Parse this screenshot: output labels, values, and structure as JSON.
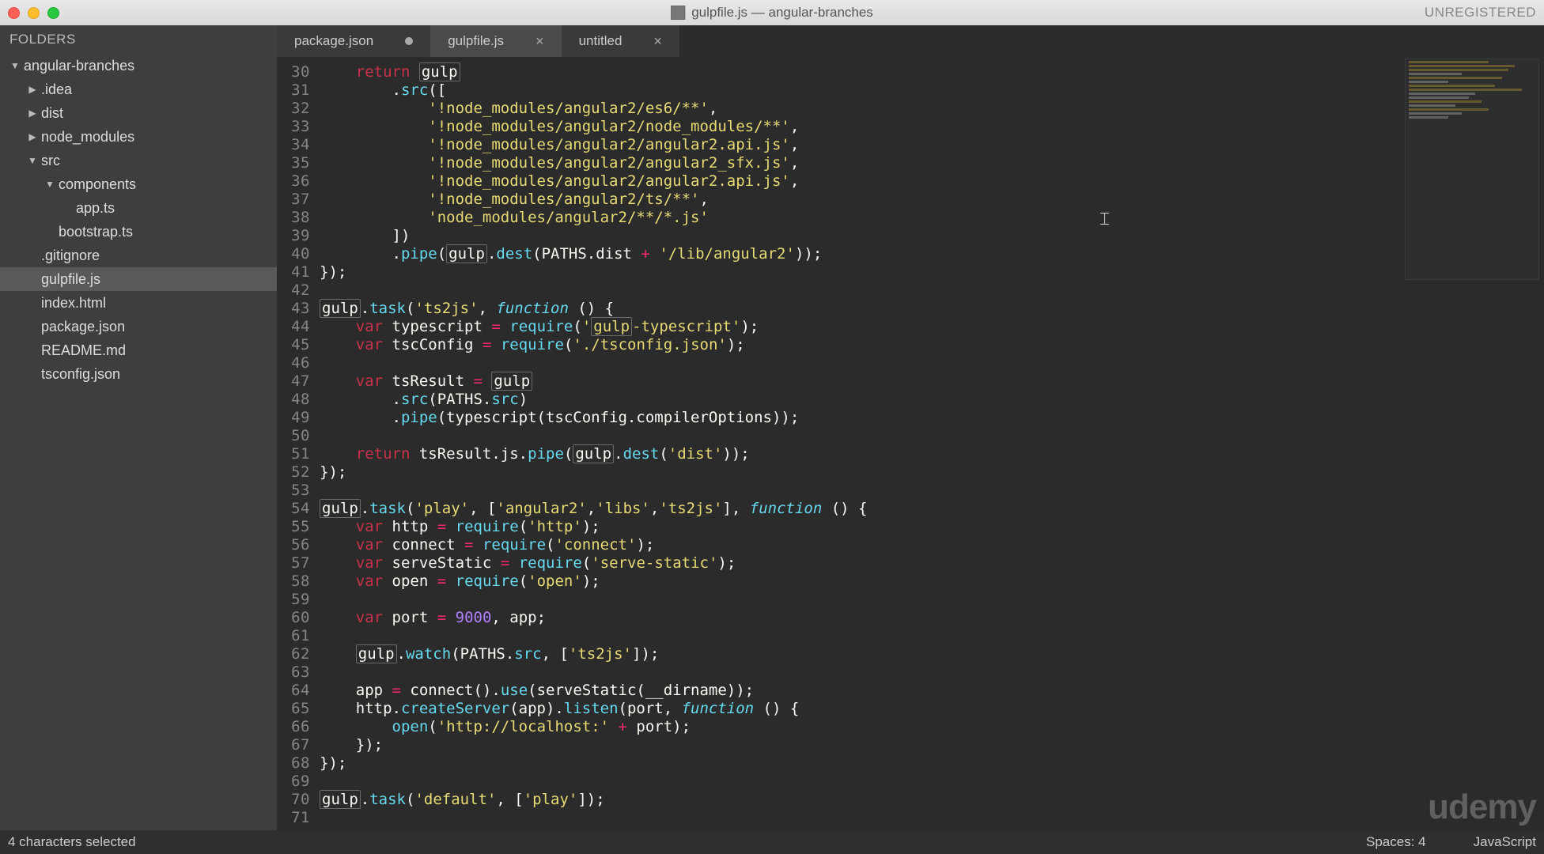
{
  "window": {
    "title": "gulpfile.js — angular-branches",
    "unregistered": "UNREGISTERED"
  },
  "sidebar": {
    "header": "FOLDERS",
    "tree": [
      {
        "label": "angular-branches",
        "indent": 0,
        "expanded": true,
        "folder": true
      },
      {
        "label": ".idea",
        "indent": 1,
        "expanded": false,
        "folder": true
      },
      {
        "label": "dist",
        "indent": 1,
        "expanded": false,
        "folder": true
      },
      {
        "label": "node_modules",
        "indent": 1,
        "expanded": false,
        "folder": true
      },
      {
        "label": "src",
        "indent": 1,
        "expanded": true,
        "folder": true
      },
      {
        "label": "components",
        "indent": 2,
        "expanded": true,
        "folder": true
      },
      {
        "label": "app.ts",
        "indent": 3,
        "folder": false
      },
      {
        "label": "bootstrap.ts",
        "indent": 2,
        "folder": false
      },
      {
        "label": ".gitignore",
        "indent": 1,
        "folder": false
      },
      {
        "label": "gulpfile.js",
        "indent": 1,
        "folder": false,
        "selected": true
      },
      {
        "label": "index.html",
        "indent": 1,
        "folder": false
      },
      {
        "label": "package.json",
        "indent": 1,
        "folder": false
      },
      {
        "label": "README.md",
        "indent": 1,
        "folder": false
      },
      {
        "label": "tsconfig.json",
        "indent": 1,
        "folder": false
      }
    ]
  },
  "tabs": [
    {
      "label": "package.json",
      "active": false,
      "dirty": true
    },
    {
      "label": "gulpfile.js",
      "active": true,
      "dirty": false
    },
    {
      "label": "untitled",
      "active": false,
      "dirty": false
    }
  ],
  "editor": {
    "first_line": 30,
    "last_line": 71,
    "lines": [
      {
        "n": 30,
        "tokens": [
          [
            "    ",
            "p"
          ],
          [
            "return",
            "kw"
          ],
          [
            " ",
            "p"
          ],
          [
            "gulp",
            "boxed"
          ]
        ]
      },
      {
        "n": 31,
        "tokens": [
          [
            "        .",
            "p"
          ],
          [
            "src",
            "method"
          ],
          [
            "([",
            "p"
          ]
        ]
      },
      {
        "n": 32,
        "tokens": [
          [
            "            ",
            "p"
          ],
          [
            "'!node_modules/angular2/es6/**'",
            "str"
          ],
          [
            ",",
            "p"
          ]
        ]
      },
      {
        "n": 33,
        "tokens": [
          [
            "            ",
            "p"
          ],
          [
            "'!node_modules/angular2/node_modules/**'",
            "str"
          ],
          [
            ",",
            "p"
          ]
        ]
      },
      {
        "n": 34,
        "tokens": [
          [
            "            ",
            "p"
          ],
          [
            "'!node_modules/angular2/angular2.api.js'",
            "str"
          ],
          [
            ",",
            "p"
          ]
        ]
      },
      {
        "n": 35,
        "tokens": [
          [
            "            ",
            "p"
          ],
          [
            "'!node_modules/angular2/angular2_sfx.js'",
            "str"
          ],
          [
            ",",
            "p"
          ]
        ]
      },
      {
        "n": 36,
        "tokens": [
          [
            "            ",
            "p"
          ],
          [
            "'!node_modules/angular2/angular2.api.js'",
            "str"
          ],
          [
            ",",
            "p"
          ]
        ]
      },
      {
        "n": 37,
        "tokens": [
          [
            "            ",
            "p"
          ],
          [
            "'!node_modules/angular2/ts/**'",
            "str"
          ],
          [
            ",",
            "p"
          ]
        ]
      },
      {
        "n": 38,
        "tokens": [
          [
            "            ",
            "p"
          ],
          [
            "'node_modules/angular2/**/*.js'",
            "str"
          ]
        ]
      },
      {
        "n": 39,
        "tokens": [
          [
            "        ])",
            "p"
          ]
        ]
      },
      {
        "n": 40,
        "tokens": [
          [
            "        .",
            "p"
          ],
          [
            "pipe",
            "method"
          ],
          [
            "(",
            "p"
          ],
          [
            "gulp",
            "boxed"
          ],
          [
            ".",
            "p"
          ],
          [
            "dest",
            "method"
          ],
          [
            "(PATHS.dist ",
            "p"
          ],
          [
            "+",
            "op"
          ],
          [
            " ",
            "p"
          ],
          [
            "'/lib/angular2'",
            "str"
          ],
          [
            "));",
            "p"
          ]
        ]
      },
      {
        "n": 41,
        "tokens": [
          [
            "});",
            "p"
          ]
        ]
      },
      {
        "n": 42,
        "tokens": [
          [
            "",
            "p"
          ]
        ]
      },
      {
        "n": 43,
        "tokens": [
          [
            "gulp",
            "boxed"
          ],
          [
            ".",
            "p"
          ],
          [
            "task",
            "method"
          ],
          [
            "(",
            "p"
          ],
          [
            "'ts2js'",
            "str"
          ],
          [
            ", ",
            "p"
          ],
          [
            "function",
            "fn"
          ],
          [
            " () {",
            "p"
          ]
        ]
      },
      {
        "n": 44,
        "tokens": [
          [
            "    ",
            "p"
          ],
          [
            "var",
            "kw"
          ],
          [
            " typescript ",
            "p"
          ],
          [
            "=",
            "op"
          ],
          [
            " ",
            "p"
          ],
          [
            "require",
            "method"
          ],
          [
            "(",
            "p"
          ],
          [
            "'",
            "str"
          ],
          [
            "gulp",
            "str boxed"
          ],
          [
            "-typescript'",
            "str"
          ],
          [
            ");",
            "p"
          ]
        ]
      },
      {
        "n": 45,
        "tokens": [
          [
            "    ",
            "p"
          ],
          [
            "var",
            "kw"
          ],
          [
            " tscConfig ",
            "p"
          ],
          [
            "=",
            "op"
          ],
          [
            " ",
            "p"
          ],
          [
            "require",
            "method"
          ],
          [
            "(",
            "p"
          ],
          [
            "'./tsconfig.json'",
            "str"
          ],
          [
            ");",
            "p"
          ]
        ]
      },
      {
        "n": 46,
        "tokens": [
          [
            "",
            "p"
          ]
        ]
      },
      {
        "n": 47,
        "tokens": [
          [
            "    ",
            "p"
          ],
          [
            "var",
            "kw"
          ],
          [
            " tsResult ",
            "p"
          ],
          [
            "=",
            "op"
          ],
          [
            " ",
            "p"
          ],
          [
            "gulp",
            "boxed"
          ]
        ]
      },
      {
        "n": 48,
        "tokens": [
          [
            "        .",
            "p"
          ],
          [
            "src",
            "method"
          ],
          [
            "(PATHS.",
            "p"
          ],
          [
            "src",
            "method"
          ],
          [
            ")",
            "p"
          ]
        ]
      },
      {
        "n": 49,
        "tokens": [
          [
            "        .",
            "p"
          ],
          [
            "pipe",
            "method"
          ],
          [
            "(typescript(tscConfig.compilerOptions));",
            "p"
          ]
        ]
      },
      {
        "n": 50,
        "tokens": [
          [
            "",
            "p"
          ]
        ]
      },
      {
        "n": 51,
        "tokens": [
          [
            "    ",
            "p"
          ],
          [
            "return",
            "kw"
          ],
          [
            " tsResult.js.",
            "p"
          ],
          [
            "pipe",
            "method"
          ],
          [
            "(",
            "p"
          ],
          [
            "gulp",
            "boxed"
          ],
          [
            ".",
            "p"
          ],
          [
            "dest",
            "method"
          ],
          [
            "(",
            "p"
          ],
          [
            "'dist'",
            "str"
          ],
          [
            "));",
            "p"
          ]
        ]
      },
      {
        "n": 52,
        "tokens": [
          [
            "});",
            "p"
          ]
        ]
      },
      {
        "n": 53,
        "tokens": [
          [
            "",
            "p"
          ]
        ]
      },
      {
        "n": 54,
        "tokens": [
          [
            "gulp",
            "boxed"
          ],
          [
            ".",
            "p"
          ],
          [
            "task",
            "method"
          ],
          [
            "(",
            "p"
          ],
          [
            "'play'",
            "str"
          ],
          [
            ", [",
            "p"
          ],
          [
            "'angular2'",
            "str"
          ],
          [
            ",",
            "p"
          ],
          [
            "'libs'",
            "str"
          ],
          [
            ",",
            "p"
          ],
          [
            "'ts2js'",
            "str"
          ],
          [
            "], ",
            "p"
          ],
          [
            "function",
            "fn"
          ],
          [
            " () {",
            "p"
          ]
        ]
      },
      {
        "n": 55,
        "tokens": [
          [
            "    ",
            "p"
          ],
          [
            "var",
            "kw"
          ],
          [
            " http ",
            "p"
          ],
          [
            "=",
            "op"
          ],
          [
            " ",
            "p"
          ],
          [
            "require",
            "method"
          ],
          [
            "(",
            "p"
          ],
          [
            "'http'",
            "str"
          ],
          [
            ");",
            "p"
          ]
        ]
      },
      {
        "n": 56,
        "tokens": [
          [
            "    ",
            "p"
          ],
          [
            "var",
            "kw"
          ],
          [
            " connect ",
            "p"
          ],
          [
            "=",
            "op"
          ],
          [
            " ",
            "p"
          ],
          [
            "require",
            "method"
          ],
          [
            "(",
            "p"
          ],
          [
            "'connect'",
            "str"
          ],
          [
            ");",
            "p"
          ]
        ]
      },
      {
        "n": 57,
        "tokens": [
          [
            "    ",
            "p"
          ],
          [
            "var",
            "kw"
          ],
          [
            " serveStatic ",
            "p"
          ],
          [
            "=",
            "op"
          ],
          [
            " ",
            "p"
          ],
          [
            "require",
            "method"
          ],
          [
            "(",
            "p"
          ],
          [
            "'serve-static'",
            "str"
          ],
          [
            ");",
            "p"
          ]
        ]
      },
      {
        "n": 58,
        "tokens": [
          [
            "    ",
            "p"
          ],
          [
            "var",
            "kw"
          ],
          [
            " open ",
            "p"
          ],
          [
            "=",
            "op"
          ],
          [
            " ",
            "p"
          ],
          [
            "require",
            "method"
          ],
          [
            "(",
            "p"
          ],
          [
            "'open'",
            "str"
          ],
          [
            ");",
            "p"
          ]
        ]
      },
      {
        "n": 59,
        "tokens": [
          [
            "",
            "p"
          ]
        ]
      },
      {
        "n": 60,
        "tokens": [
          [
            "    ",
            "p"
          ],
          [
            "var",
            "kw"
          ],
          [
            " port ",
            "p"
          ],
          [
            "=",
            "op"
          ],
          [
            " ",
            "p"
          ],
          [
            "9000",
            "num"
          ],
          [
            ", app;",
            "p"
          ]
        ]
      },
      {
        "n": 61,
        "tokens": [
          [
            "",
            "p"
          ]
        ]
      },
      {
        "n": 62,
        "tokens": [
          [
            "    ",
            "p"
          ],
          [
            "gulp",
            "boxed"
          ],
          [
            ".",
            "p"
          ],
          [
            "watch",
            "method"
          ],
          [
            "(PATHS.",
            "p"
          ],
          [
            "src",
            "method"
          ],
          [
            ", [",
            "p"
          ],
          [
            "'ts2js'",
            "str"
          ],
          [
            "]);",
            "p"
          ]
        ]
      },
      {
        "n": 63,
        "tokens": [
          [
            "",
            "p"
          ]
        ]
      },
      {
        "n": 64,
        "tokens": [
          [
            "    app ",
            "p"
          ],
          [
            "=",
            "op"
          ],
          [
            " connect().",
            "p"
          ],
          [
            "use",
            "method"
          ],
          [
            "(serveStatic(__dirname));",
            "p"
          ]
        ]
      },
      {
        "n": 65,
        "tokens": [
          [
            "    http.",
            "p"
          ],
          [
            "createServer",
            "method"
          ],
          [
            "(app).",
            "p"
          ],
          [
            "listen",
            "method"
          ],
          [
            "(port, ",
            "p"
          ],
          [
            "function",
            "fn"
          ],
          [
            " () {",
            "p"
          ]
        ]
      },
      {
        "n": 66,
        "tokens": [
          [
            "        ",
            "p"
          ],
          [
            "open",
            "method"
          ],
          [
            "(",
            "p"
          ],
          [
            "'http://localhost:'",
            "str"
          ],
          [
            " ",
            "p"
          ],
          [
            "+",
            "op"
          ],
          [
            " port);",
            "p"
          ]
        ]
      },
      {
        "n": 67,
        "tokens": [
          [
            "    });",
            "p"
          ]
        ]
      },
      {
        "n": 68,
        "tokens": [
          [
            "});",
            "p"
          ]
        ]
      },
      {
        "n": 69,
        "tokens": [
          [
            "",
            "p"
          ]
        ]
      },
      {
        "n": 70,
        "tokens": [
          [
            "gulp",
            "boxed"
          ],
          [
            ".",
            "p"
          ],
          [
            "task",
            "method"
          ],
          [
            "(",
            "p"
          ],
          [
            "'default'",
            "str"
          ],
          [
            ", [",
            "p"
          ],
          [
            "'play'",
            "str"
          ],
          [
            "]);",
            "p"
          ]
        ]
      },
      {
        "n": 71,
        "tokens": [
          [
            "",
            "p"
          ]
        ]
      }
    ]
  },
  "statusbar": {
    "left": "4 characters selected",
    "spaces": "Spaces: 4",
    "syntax": "JavaScript"
  },
  "watermark": "udemy"
}
